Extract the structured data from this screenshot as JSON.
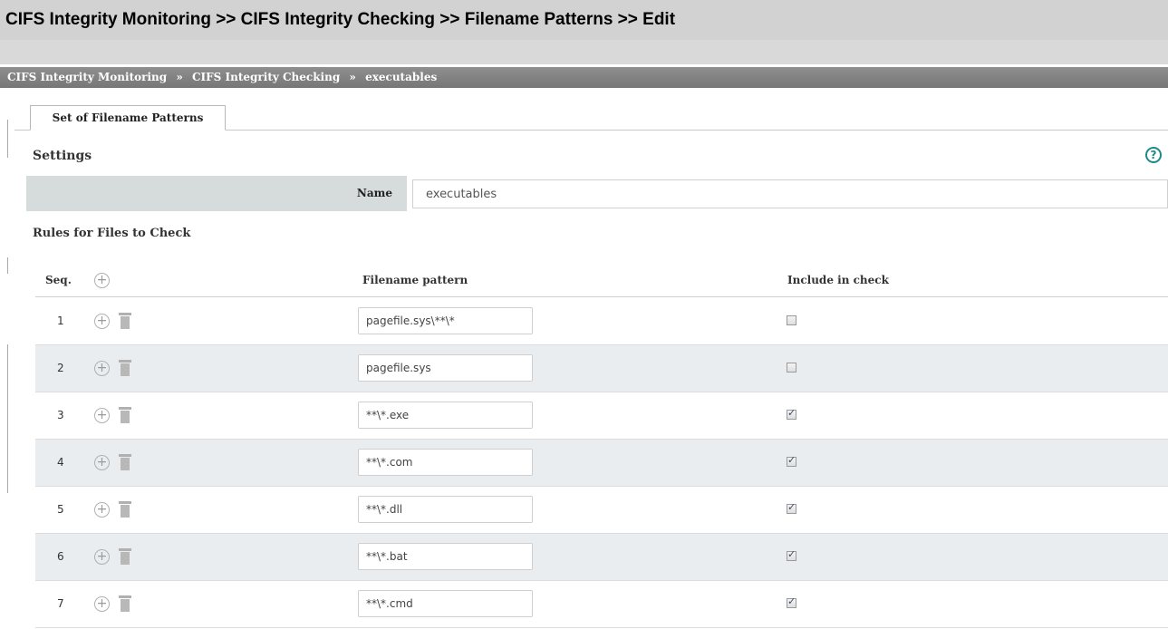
{
  "page_title": "CIFS Integrity Monitoring >> CIFS Integrity Checking >> Filename Patterns >> Edit",
  "breadcrumb": {
    "items": [
      "CIFS Integrity Monitoring",
      "CIFS Integrity Checking",
      "executables"
    ],
    "separator": "»"
  },
  "tabs": [
    {
      "label": "Set of Filename Patterns"
    }
  ],
  "settings": {
    "title": "Settings",
    "help_icon": "help-circle-icon",
    "name_label": "Name",
    "name_value": "executables"
  },
  "rules": {
    "title": "Rules for Files to Check",
    "columns": {
      "seq": "Seq.",
      "pattern": "Filename pattern",
      "include": "Include in check"
    },
    "rows": [
      {
        "seq": "1",
        "pattern": "pagefile.sys\\**\\*",
        "include": false
      },
      {
        "seq": "2",
        "pattern": "pagefile.sys",
        "include": false
      },
      {
        "seq": "3",
        "pattern": "**\\*.exe",
        "include": true
      },
      {
        "seq": "4",
        "pattern": "**\\*.com",
        "include": true
      },
      {
        "seq": "5",
        "pattern": "**\\*.dll",
        "include": true
      },
      {
        "seq": "6",
        "pattern": "**\\*.bat",
        "include": true
      },
      {
        "seq": "7",
        "pattern": "**\\*.cmd",
        "include": true
      }
    ]
  },
  "colors": {
    "header_bg": "#d2d2d2",
    "breadcrumb_bg": "#808080",
    "name_label_bg": "#d6dbdc",
    "alt_row_bg": "#e9edf0",
    "help_icon": "#1b8a8a"
  }
}
